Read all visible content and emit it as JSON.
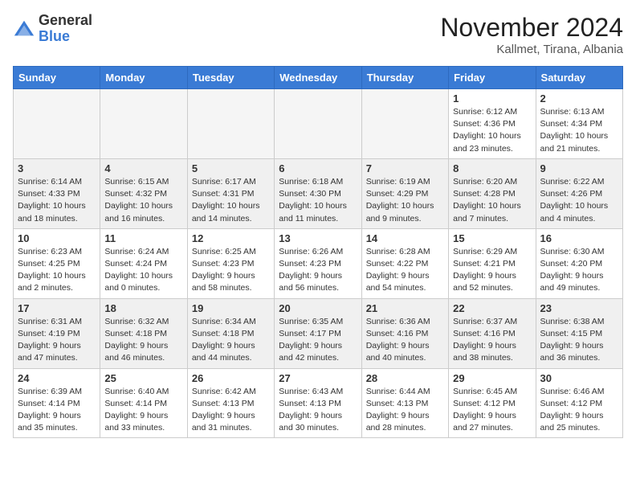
{
  "header": {
    "logo_general": "General",
    "logo_blue": "Blue",
    "month_title": "November 2024",
    "location": "Kallmet, Tirana, Albania"
  },
  "weekdays": [
    "Sunday",
    "Monday",
    "Tuesday",
    "Wednesday",
    "Thursday",
    "Friday",
    "Saturday"
  ],
  "weeks": [
    [
      {
        "day": "",
        "info": ""
      },
      {
        "day": "",
        "info": ""
      },
      {
        "day": "",
        "info": ""
      },
      {
        "day": "",
        "info": ""
      },
      {
        "day": "",
        "info": ""
      },
      {
        "day": "1",
        "info": "Sunrise: 6:12 AM\nSunset: 4:36 PM\nDaylight: 10 hours and 23 minutes."
      },
      {
        "day": "2",
        "info": "Sunrise: 6:13 AM\nSunset: 4:34 PM\nDaylight: 10 hours and 21 minutes."
      }
    ],
    [
      {
        "day": "3",
        "info": "Sunrise: 6:14 AM\nSunset: 4:33 PM\nDaylight: 10 hours and 18 minutes."
      },
      {
        "day": "4",
        "info": "Sunrise: 6:15 AM\nSunset: 4:32 PM\nDaylight: 10 hours and 16 minutes."
      },
      {
        "day": "5",
        "info": "Sunrise: 6:17 AM\nSunset: 4:31 PM\nDaylight: 10 hours and 14 minutes."
      },
      {
        "day": "6",
        "info": "Sunrise: 6:18 AM\nSunset: 4:30 PM\nDaylight: 10 hours and 11 minutes."
      },
      {
        "day": "7",
        "info": "Sunrise: 6:19 AM\nSunset: 4:29 PM\nDaylight: 10 hours and 9 minutes."
      },
      {
        "day": "8",
        "info": "Sunrise: 6:20 AM\nSunset: 4:28 PM\nDaylight: 10 hours and 7 minutes."
      },
      {
        "day": "9",
        "info": "Sunrise: 6:22 AM\nSunset: 4:26 PM\nDaylight: 10 hours and 4 minutes."
      }
    ],
    [
      {
        "day": "10",
        "info": "Sunrise: 6:23 AM\nSunset: 4:25 PM\nDaylight: 10 hours and 2 minutes."
      },
      {
        "day": "11",
        "info": "Sunrise: 6:24 AM\nSunset: 4:24 PM\nDaylight: 10 hours and 0 minutes."
      },
      {
        "day": "12",
        "info": "Sunrise: 6:25 AM\nSunset: 4:23 PM\nDaylight: 9 hours and 58 minutes."
      },
      {
        "day": "13",
        "info": "Sunrise: 6:26 AM\nSunset: 4:23 PM\nDaylight: 9 hours and 56 minutes."
      },
      {
        "day": "14",
        "info": "Sunrise: 6:28 AM\nSunset: 4:22 PM\nDaylight: 9 hours and 54 minutes."
      },
      {
        "day": "15",
        "info": "Sunrise: 6:29 AM\nSunset: 4:21 PM\nDaylight: 9 hours and 52 minutes."
      },
      {
        "day": "16",
        "info": "Sunrise: 6:30 AM\nSunset: 4:20 PM\nDaylight: 9 hours and 49 minutes."
      }
    ],
    [
      {
        "day": "17",
        "info": "Sunrise: 6:31 AM\nSunset: 4:19 PM\nDaylight: 9 hours and 47 minutes."
      },
      {
        "day": "18",
        "info": "Sunrise: 6:32 AM\nSunset: 4:18 PM\nDaylight: 9 hours and 46 minutes."
      },
      {
        "day": "19",
        "info": "Sunrise: 6:34 AM\nSunset: 4:18 PM\nDaylight: 9 hours and 44 minutes."
      },
      {
        "day": "20",
        "info": "Sunrise: 6:35 AM\nSunset: 4:17 PM\nDaylight: 9 hours and 42 minutes."
      },
      {
        "day": "21",
        "info": "Sunrise: 6:36 AM\nSunset: 4:16 PM\nDaylight: 9 hours and 40 minutes."
      },
      {
        "day": "22",
        "info": "Sunrise: 6:37 AM\nSunset: 4:16 PM\nDaylight: 9 hours and 38 minutes."
      },
      {
        "day": "23",
        "info": "Sunrise: 6:38 AM\nSunset: 4:15 PM\nDaylight: 9 hours and 36 minutes."
      }
    ],
    [
      {
        "day": "24",
        "info": "Sunrise: 6:39 AM\nSunset: 4:14 PM\nDaylight: 9 hours and 35 minutes."
      },
      {
        "day": "25",
        "info": "Sunrise: 6:40 AM\nSunset: 4:14 PM\nDaylight: 9 hours and 33 minutes."
      },
      {
        "day": "26",
        "info": "Sunrise: 6:42 AM\nSunset: 4:13 PM\nDaylight: 9 hours and 31 minutes."
      },
      {
        "day": "27",
        "info": "Sunrise: 6:43 AM\nSunset: 4:13 PM\nDaylight: 9 hours and 30 minutes."
      },
      {
        "day": "28",
        "info": "Sunrise: 6:44 AM\nSunset: 4:13 PM\nDaylight: 9 hours and 28 minutes."
      },
      {
        "day": "29",
        "info": "Sunrise: 6:45 AM\nSunset: 4:12 PM\nDaylight: 9 hours and 27 minutes."
      },
      {
        "day": "30",
        "info": "Sunrise: 6:46 AM\nSunset: 4:12 PM\nDaylight: 9 hours and 25 minutes."
      }
    ]
  ]
}
